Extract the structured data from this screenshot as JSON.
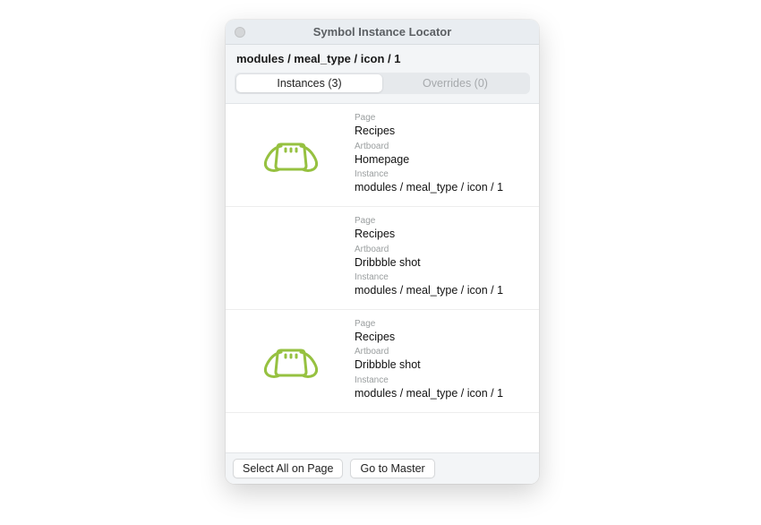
{
  "window": {
    "title": "Symbol Instance Locator"
  },
  "header": {
    "breadcrumb": "modules / meal_type / icon / 1",
    "tabs": {
      "instances": "Instances (3)",
      "overrides": "Overrides (0)"
    }
  },
  "labels": {
    "page": "Page",
    "artboard": "Artboard",
    "instance": "Instance"
  },
  "items": [
    {
      "page": "Recipes",
      "artboard": "Homepage",
      "instance": "modules / meal_type / icon / 1",
      "show_icon": true
    },
    {
      "page": "Recipes",
      "artboard": "Dribbble shot",
      "instance": "modules / meal_type / icon / 1",
      "show_icon": false
    },
    {
      "page": "Recipes",
      "artboard": "Dribbble shot",
      "instance": "modules / meal_type / icon / 1",
      "show_icon": true
    }
  ],
  "footer": {
    "select_all": "Select All on Page",
    "go_to_master": "Go to Master"
  },
  "colors": {
    "icon_stroke": "#96c140"
  }
}
